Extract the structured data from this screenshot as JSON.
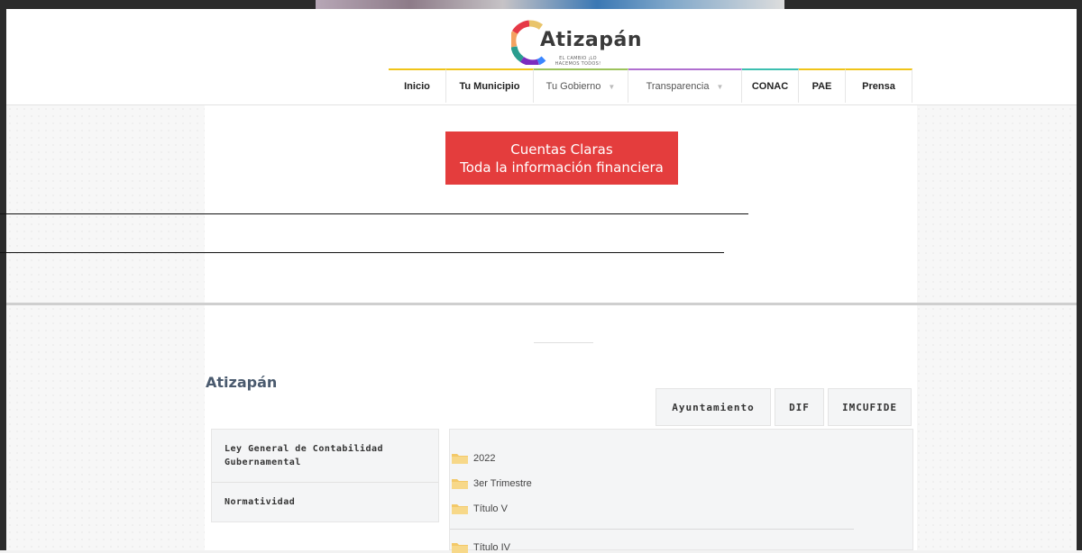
{
  "brand": {
    "name": "Atizapán",
    "tagline": "EL CAMBIO ¡LO HACEMOS TODOS!",
    "colors": {
      "accent_red": "#e43d3d",
      "nav_top": "#f0c419",
      "title": "#4a5a6e"
    }
  },
  "nav": {
    "items": [
      {
        "label": "Inicio",
        "dropdown": false
      },
      {
        "label": "Tu Municipio",
        "dropdown": false
      },
      {
        "label": "Tu Gobierno",
        "dropdown": true
      },
      {
        "label": "Transparencia",
        "dropdown": true
      },
      {
        "label": "CONAC",
        "dropdown": false
      },
      {
        "label": "PAE",
        "dropdown": false
      },
      {
        "label": "Prensa",
        "dropdown": false
      }
    ],
    "caret": "▼"
  },
  "banner": {
    "line1": "Cuentas Claras",
    "line2": "Toda la información financiera"
  },
  "section": {
    "title": "Atizapán",
    "tabs": [
      "Ayuntamiento",
      "DIF",
      "IMCUFIDE"
    ],
    "side_menu": [
      "Ley General de Contabilidad Gubernamental",
      "Normatividad"
    ],
    "tree": [
      {
        "label": "2022",
        "icon": "folder-icon"
      },
      {
        "label": "3er Trimestre",
        "icon": "folder-icon"
      },
      {
        "label": "Título V",
        "icon": "folder-icon"
      },
      {
        "label": "Título IV",
        "icon": "folder-icon"
      }
    ]
  }
}
